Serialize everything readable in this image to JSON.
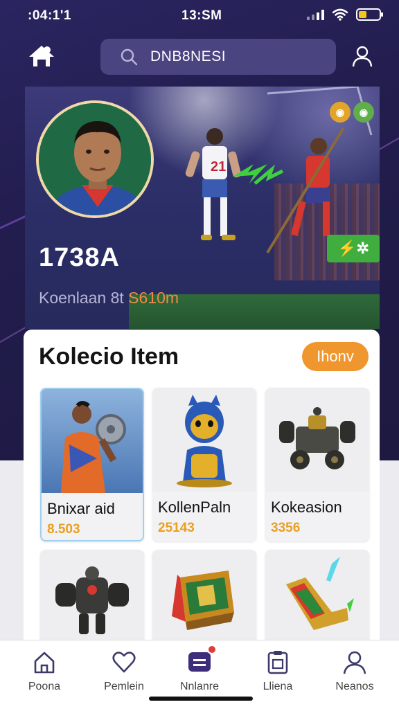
{
  "status_bar": {
    "time_left": ":04:1'1",
    "time_center": "13:SM"
  },
  "header": {
    "search_text": "DNB8NESI"
  },
  "hero": {
    "player_number": "1738A",
    "meta_label": "Koenlaan 8t",
    "meta_value": "S610m"
  },
  "collection": {
    "title": "Kolecio Item",
    "view_button": "Ihonv",
    "items": [
      {
        "name": "Bnixar aid",
        "price": "8.503"
      },
      {
        "name": "KollenPaln",
        "price": "25143"
      },
      {
        "name": "Kokeasion",
        "price": "3356"
      }
    ]
  },
  "bottom_nav": {
    "items": [
      {
        "label": "Poona"
      },
      {
        "label": "Pemlein"
      },
      {
        "label": "Nnlanre"
      },
      {
        "label": "Lliena"
      },
      {
        "label": "Neanos"
      }
    ]
  },
  "colors": {
    "accent_orange": "#f0962e",
    "price_gold": "#e9a020",
    "nav_active": "#3d2d7a",
    "badge_green": "#3fae3f"
  },
  "icons": [
    "home-icon",
    "search-icon",
    "user-icon",
    "heart-icon",
    "wallet-icon",
    "clipboard-icon",
    "profile-icon"
  ]
}
